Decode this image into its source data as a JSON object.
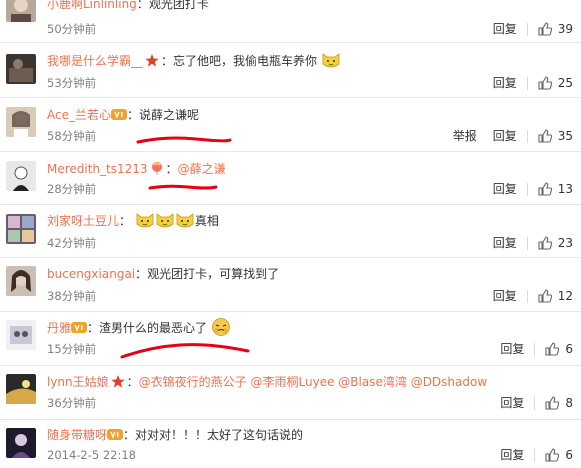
{
  "labels": {
    "reply": "回复",
    "report": "举报",
    "colon": "："
  },
  "comments": [
    {
      "user": "小鹿啊Linlinling",
      "text": "观光团打卡",
      "time": "50分钟前",
      "likes": "39"
    },
    {
      "user": "我哪是什么学霸__",
      "text": "忘了他吧，我偷电瓶车养你",
      "time": "53分钟前",
      "likes": "25"
    },
    {
      "user": "Ace_兰若心",
      "text": "说薛之谦呢",
      "time": "58分钟前",
      "likes": "35"
    },
    {
      "user": "Meredith_ts1213",
      "mention": "@薛之谦",
      "time": "28分钟前",
      "likes": "13"
    },
    {
      "user": "刘家呀土豆儿",
      "text": "真相",
      "time": "42分钟前",
      "likes": "23"
    },
    {
      "user": "bucengxiangai",
      "text": "观光团打卡，可算找到了",
      "time": "38分钟前",
      "likes": "12"
    },
    {
      "user": "丹雅",
      "text": "渣男什么的最恶心了",
      "time": "15分钟前",
      "likes": "6"
    },
    {
      "user": "lynn王姑娘",
      "mentions": [
        "@衣锦夜行的燕公子",
        "@李雨桐Luyee",
        "@Blase湾湾",
        "@DDshadow"
      ],
      "time": "36分钟前",
      "likes": "8"
    },
    {
      "user": "随身带糖呀",
      "text": "对对对！！！太好了这句话说的",
      "time": "2014-2-5 22:18",
      "likes": "6"
    }
  ],
  "colors": {
    "username": "#eb7350",
    "time": "#808080",
    "annotation": "#e60012"
  }
}
